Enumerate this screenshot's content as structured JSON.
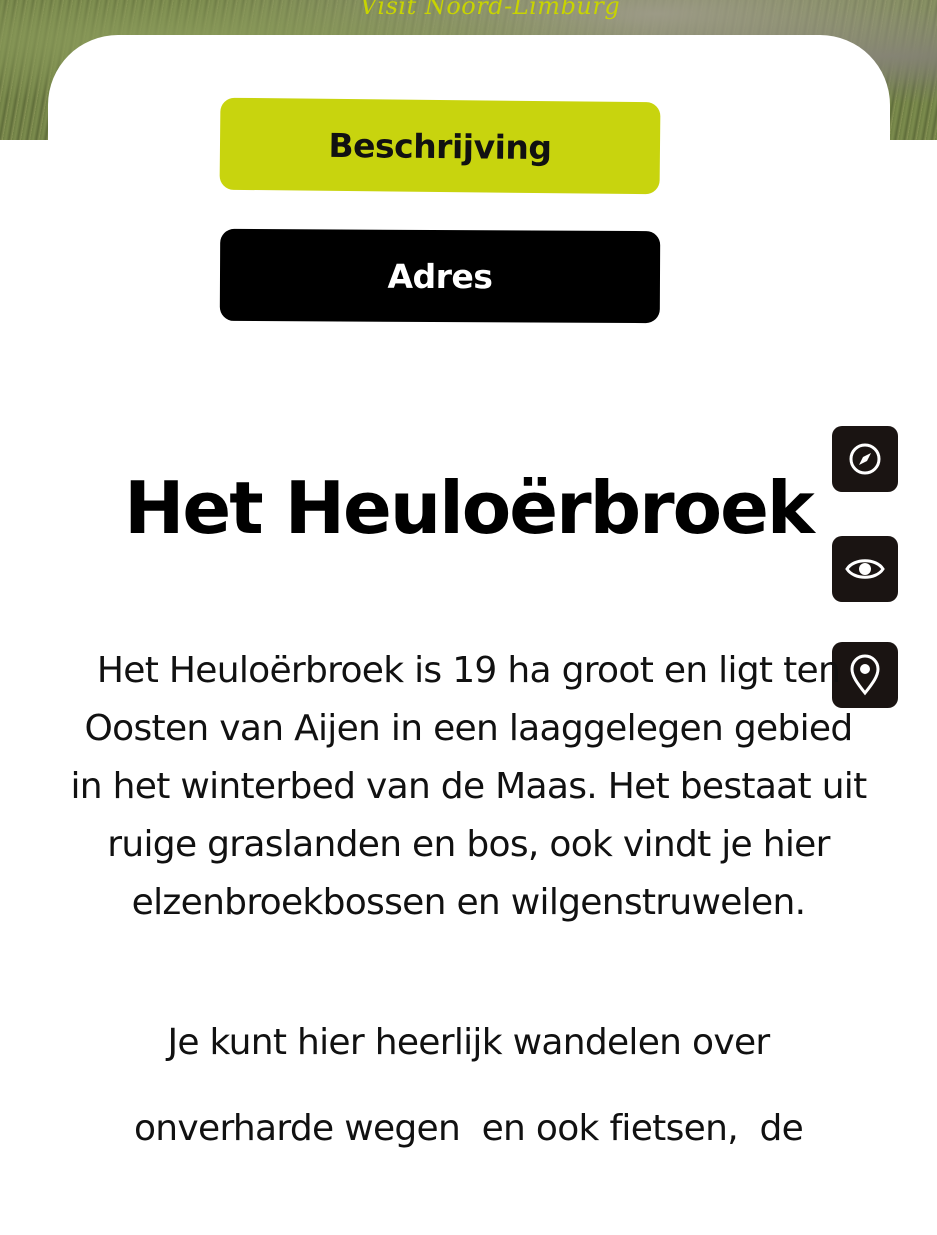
{
  "brand": {
    "name": "Visit Noord-Limburg",
    "accent": "#c8d40e"
  },
  "tabs": [
    {
      "label": "Beschrijving",
      "state": "active",
      "color": "#c8d40e"
    },
    {
      "label": "Adres",
      "state": "inactive",
      "color": "#000000"
    }
  ],
  "title": "Het Heuloërbroek",
  "side_actions": [
    {
      "icon": "compass-icon"
    },
    {
      "icon": "eye-icon"
    },
    {
      "icon": "map-pin-icon"
    }
  ],
  "description": {
    "lines": [
      "Het Heuloërbroek is 19 ha groot en ligt ten",
      "Oosten van Aijen in een laaggelegen gebied",
      "in het winterbed van de Maas. Het bestaat uit",
      "ruige graslanden en bos, ook vindt je hier",
      "elzenbroekbossen en wilgenstruwelen."
    ]
  },
  "paragraph2": {
    "lines": [
      "Je kunt hier heerlijk wandelen over",
      "onverharde wegen  en ook fietsen,  de"
    ]
  }
}
